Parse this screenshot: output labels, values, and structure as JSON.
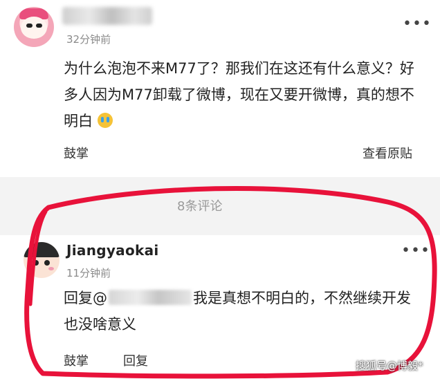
{
  "post": {
    "time": "32分钟前",
    "more_icon": "more-dots-icon",
    "text": "为什么泡泡不来M77了？那我们在这还有什么意义？好多人因为M77卸载了微博，现在又要开微博，真的想不明白",
    "like_label": "鼓掌",
    "view_original_label": "查看原贴"
  },
  "comments": {
    "count_label": "8条评论"
  },
  "reply": {
    "author": "Jiangyaokai",
    "time": "11分钟前",
    "prefix": "回复",
    "mention_symbol": "@",
    "text": "我是真想不明白的，不然继续开发也没啥意义",
    "like_label": "鼓掌",
    "reply_label": "回复",
    "more_icon": "more-dots-icon"
  },
  "watermark": "搜狐号@博毅*",
  "colors": {
    "annotation_circle": "#e8123a",
    "separator": "#f3f3f3",
    "secondary_text": "#8a8a8a"
  }
}
